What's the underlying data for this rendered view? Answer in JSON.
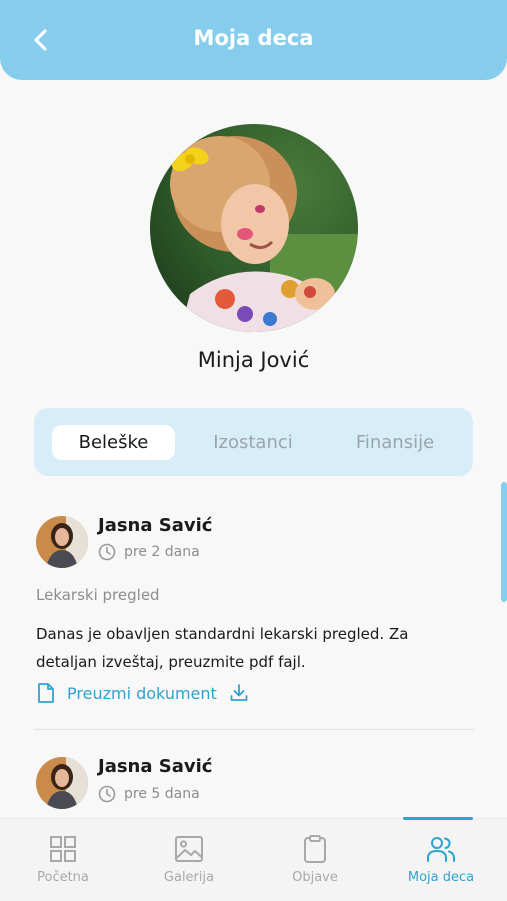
{
  "header": {
    "title": "Moja deca",
    "back_icon": "chevron-left-icon"
  },
  "child": {
    "name": "Minja Jović"
  },
  "tabs": [
    {
      "label": "Beleške",
      "active": true
    },
    {
      "label": "Izostanci",
      "active": false
    },
    {
      "label": "Finansije",
      "active": false
    }
  ],
  "notes": [
    {
      "author": "Jasna Savić",
      "time": "pre 2 dana",
      "title": "Lekarski pregled",
      "body": "Danas je obavljen standardni lekarski pregled. Za detaljan izveštaj, preuzmite pdf fajl.",
      "download_label": "Preuzmi dokument"
    },
    {
      "author": "Jasna Savić",
      "time": "pre 5 dana"
    }
  ],
  "nav": {
    "items": [
      {
        "label": "Početna",
        "icon": "grid-icon",
        "active": false
      },
      {
        "label": "Galerija",
        "icon": "image-icon",
        "active": false
      },
      {
        "label": "Objave",
        "icon": "clipboard-icon",
        "active": false
      },
      {
        "label": "Moja deca",
        "icon": "users-icon",
        "active": true
      }
    ]
  },
  "colors": {
    "accent": "#86ccec",
    "link": "#2fa3cf",
    "tabs_bg": "#d7edf8"
  }
}
